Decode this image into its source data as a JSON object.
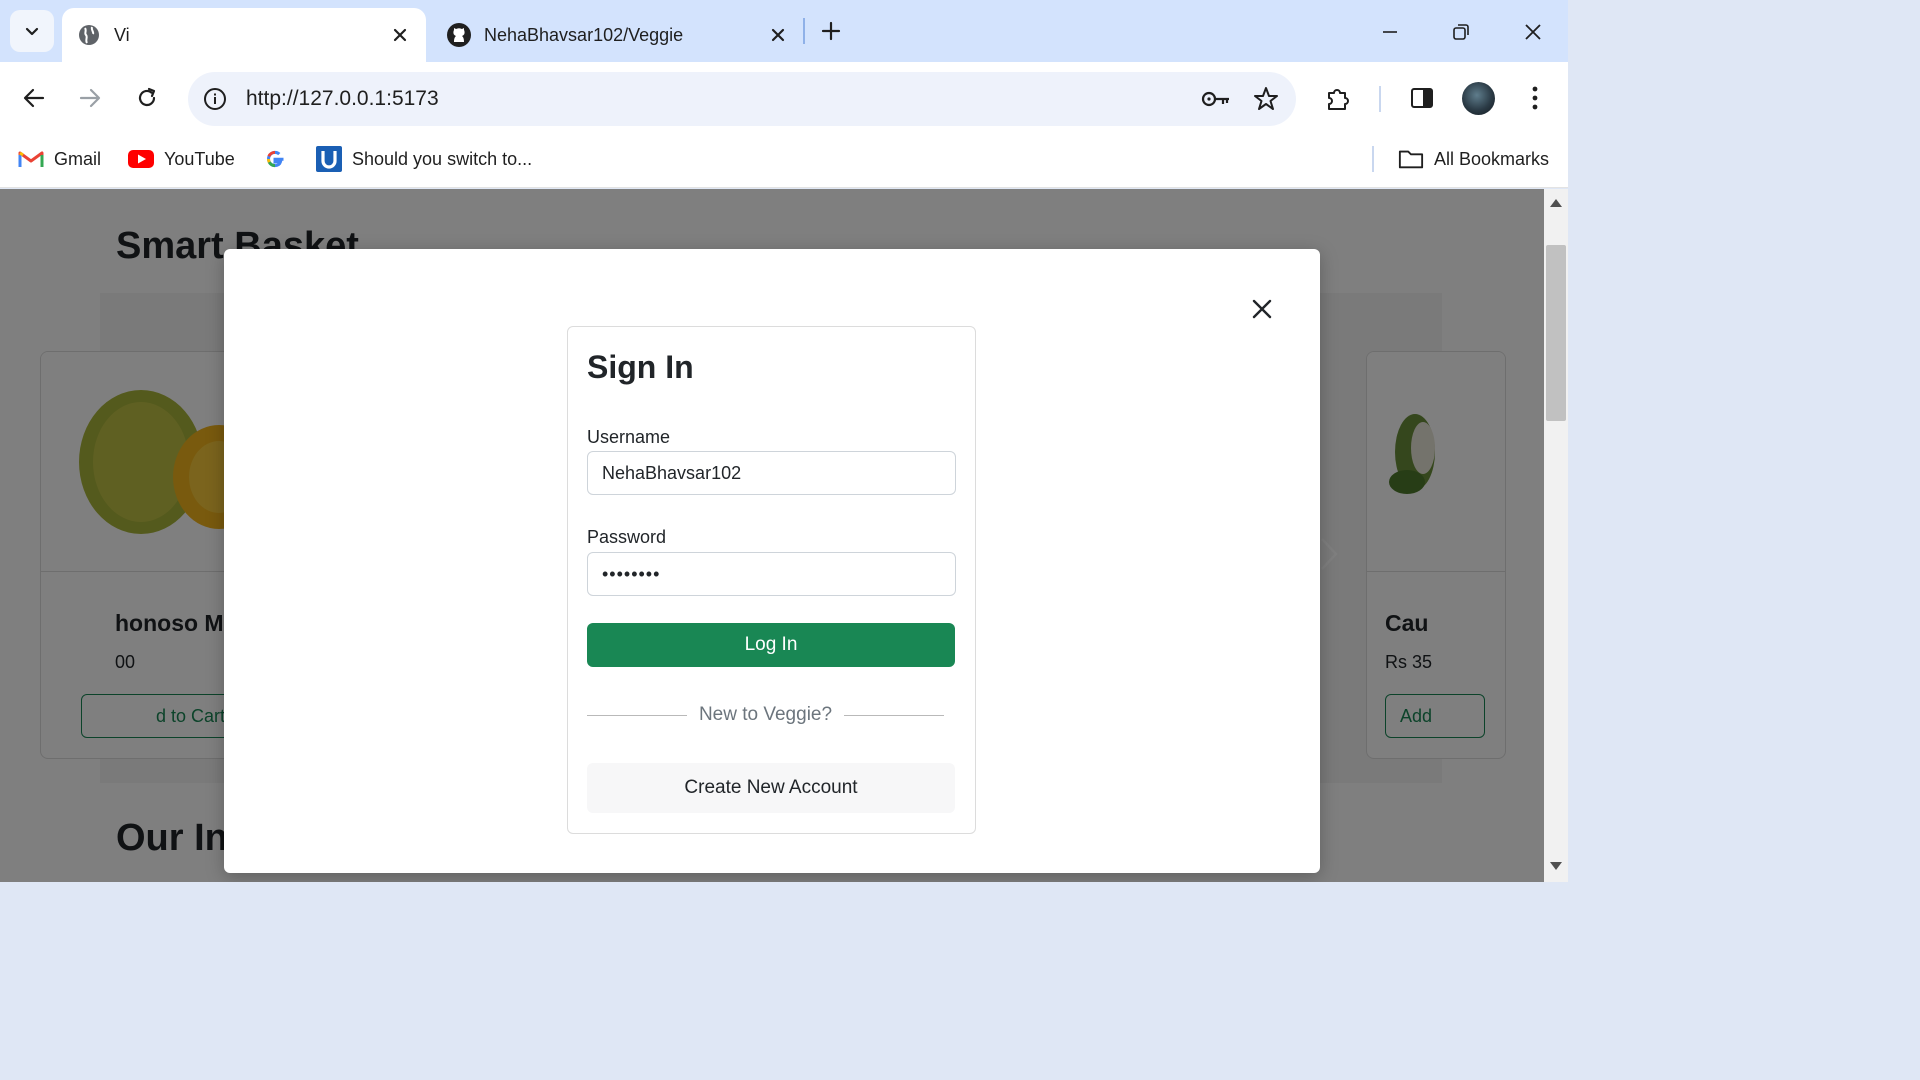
{
  "browser": {
    "tabs": [
      {
        "title": "Vi",
        "favicon": "globe-icon",
        "active": true
      },
      {
        "title": "NehaBhavsar102/Veggie",
        "favicon": "github-icon",
        "active": false
      }
    ],
    "url": "http://127.0.0.1:5173",
    "bookmarks": [
      {
        "label": "Gmail",
        "icon": "gmail-icon"
      },
      {
        "label": "YouTube",
        "icon": "youtube-icon"
      },
      {
        "label": "",
        "icon": "google-icon"
      },
      {
        "label": "Should you switch to...",
        "icon": "u-icon"
      }
    ],
    "all_bookmarks_label": "All Bookmarks"
  },
  "page": {
    "title": "Smart Basket",
    "section2_title": "Our In",
    "cards": [
      {
        "name": "honoso Ma",
        "price": "00",
        "button": "d to Cart"
      },
      {
        "name": "Cau",
        "price": "Rs 35",
        "button": "Add"
      }
    ]
  },
  "modal": {
    "title": "Sign In",
    "username_label": "Username",
    "username_value": "NehaBhavsar102",
    "password_label": "Password",
    "password_value": "••••••••",
    "login_button": "Log In",
    "divider_text": "New to Veggie?",
    "create_button": "Create New Account"
  },
  "colors": {
    "primary_green": "#198754",
    "tabstrip": "#d3e3fd",
    "omnibox": "#eef2fb",
    "backdrop": "rgba(0,0,0,0.5)"
  }
}
